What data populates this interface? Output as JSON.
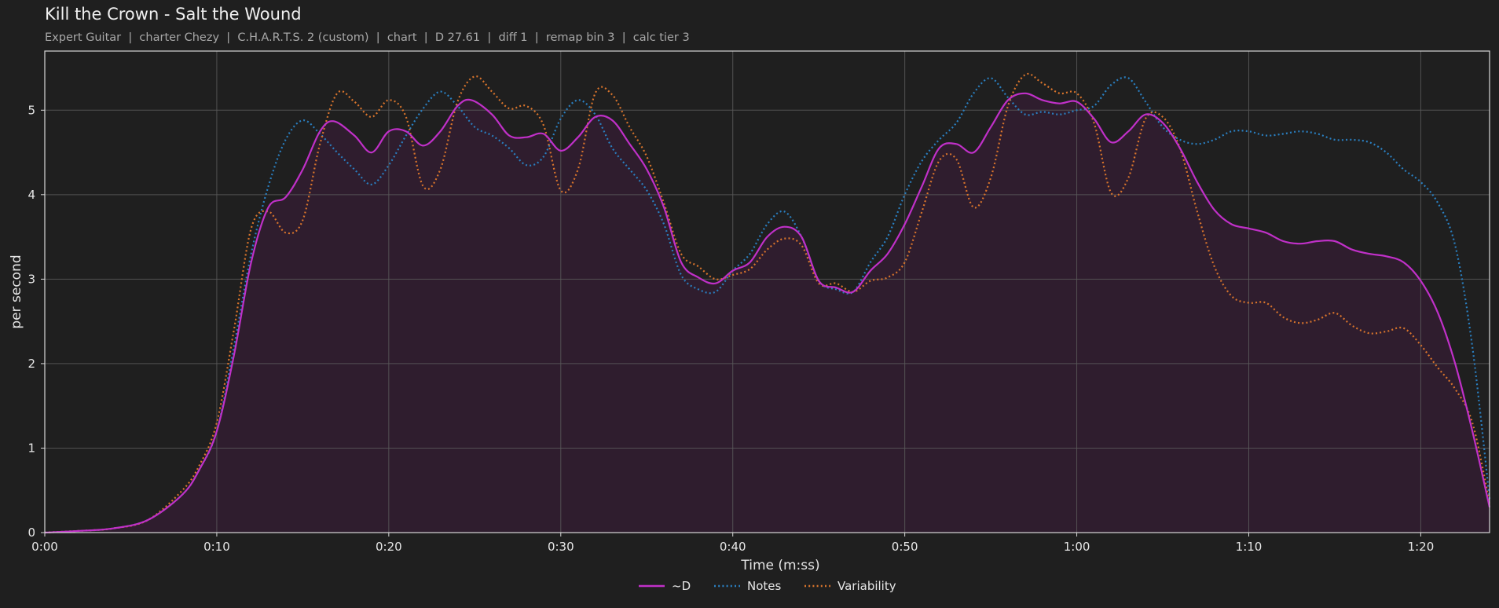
{
  "title": "Kill the Crown - Salt the Wound",
  "subtitle": "Expert Guitar  |  charter Chezy  |  C.H.A.R.T.S. 2 (custom)  |  chart  |  D 27.61  |  diff 1  |  remap bin 3  |  calc tier 3",
  "colors": {
    "background": "#1f1f1f",
    "grid": "#5a5a5a",
    "axis": "#d8d8d8",
    "fill": "#2f1d2e"
  },
  "chart_data": {
    "type": "line",
    "xlabel": "Time (m:ss)",
    "ylabel": "per second",
    "xlim": [
      0,
      84
    ],
    "ylim": [
      0,
      5.7
    ],
    "grid": true,
    "legend_position": "bottom-center",
    "x_ticks": [
      0,
      10,
      20,
      30,
      40,
      50,
      60,
      70,
      80
    ],
    "x_tick_labels": [
      "0:00",
      "0:10",
      "0:20",
      "0:30",
      "0:40",
      "0:50",
      "1:00",
      "1:10",
      "1:20"
    ],
    "y_ticks": [
      0,
      1,
      2,
      3,
      4,
      5
    ],
    "y_tick_labels": [
      "0",
      "1",
      "2",
      "3",
      "4",
      "5"
    ],
    "series": [
      {
        "name": "~D",
        "color": "#c030c8",
        "style": "solid",
        "filled": true,
        "points": [
          [
            0,
            0
          ],
          [
            2,
            0.02
          ],
          [
            4,
            0.05
          ],
          [
            6,
            0.15
          ],
          [
            8,
            0.45
          ],
          [
            9,
            0.75
          ],
          [
            10,
            1.2
          ],
          [
            11,
            2.1
          ],
          [
            12,
            3.2
          ],
          [
            13,
            3.85
          ],
          [
            14,
            3.97
          ],
          [
            15,
            4.3
          ],
          [
            16,
            4.75
          ],
          [
            16.8,
            4.87
          ],
          [
            18,
            4.7
          ],
          [
            19,
            4.5
          ],
          [
            20,
            4.75
          ],
          [
            21,
            4.75
          ],
          [
            22,
            4.58
          ],
          [
            23,
            4.75
          ],
          [
            24,
            5.05
          ],
          [
            24.8,
            5.12
          ],
          [
            26,
            4.95
          ],
          [
            27,
            4.7
          ],
          [
            28,
            4.68
          ],
          [
            29,
            4.72
          ],
          [
            30,
            4.52
          ],
          [
            31,
            4.68
          ],
          [
            32,
            4.92
          ],
          [
            33,
            4.88
          ],
          [
            34,
            4.6
          ],
          [
            35,
            4.3
          ],
          [
            36,
            3.85
          ],
          [
            37,
            3.2
          ],
          [
            38,
            3.02
          ],
          [
            39,
            2.95
          ],
          [
            40,
            3.1
          ],
          [
            41,
            3.2
          ],
          [
            42,
            3.5
          ],
          [
            43,
            3.62
          ],
          [
            44,
            3.5
          ],
          [
            45,
            2.98
          ],
          [
            46,
            2.9
          ],
          [
            47,
            2.85
          ],
          [
            48,
            3.1
          ],
          [
            49,
            3.3
          ],
          [
            50,
            3.65
          ],
          [
            51,
            4.1
          ],
          [
            52,
            4.55
          ],
          [
            53,
            4.6
          ],
          [
            54,
            4.5
          ],
          [
            55,
            4.8
          ],
          [
            56,
            5.12
          ],
          [
            57,
            5.2
          ],
          [
            58,
            5.12
          ],
          [
            59,
            5.08
          ],
          [
            60,
            5.1
          ],
          [
            61,
            4.9
          ],
          [
            62,
            4.62
          ],
          [
            63,
            4.75
          ],
          [
            64,
            4.95
          ],
          [
            65,
            4.85
          ],
          [
            66,
            4.55
          ],
          [
            67,
            4.15
          ],
          [
            68,
            3.82
          ],
          [
            69,
            3.65
          ],
          [
            70,
            3.6
          ],
          [
            71,
            3.55
          ],
          [
            72,
            3.45
          ],
          [
            73,
            3.42
          ],
          [
            74,
            3.45
          ],
          [
            75,
            3.45
          ],
          [
            76,
            3.35
          ],
          [
            77,
            3.3
          ],
          [
            78,
            3.27
          ],
          [
            79,
            3.2
          ],
          [
            80,
            2.98
          ],
          [
            81,
            2.6
          ],
          [
            82,
            2.0
          ],
          [
            83,
            1.2
          ],
          [
            84,
            0.3
          ]
        ]
      },
      {
        "name": "Notes",
        "color": "#2a7fc0",
        "style": "dotted",
        "filled": false,
        "points": [
          [
            0,
            0
          ],
          [
            2,
            0.02
          ],
          [
            4,
            0.05
          ],
          [
            6,
            0.15
          ],
          [
            8,
            0.45
          ],
          [
            9,
            0.75
          ],
          [
            10,
            1.2
          ],
          [
            11,
            2.2
          ],
          [
            12,
            3.3
          ],
          [
            13,
            4.1
          ],
          [
            14,
            4.65
          ],
          [
            15,
            4.88
          ],
          [
            16,
            4.72
          ],
          [
            17,
            4.5
          ],
          [
            18,
            4.3
          ],
          [
            19,
            4.12
          ],
          [
            20,
            4.35
          ],
          [
            21,
            4.7
          ],
          [
            22,
            5.02
          ],
          [
            23,
            5.22
          ],
          [
            24,
            5.05
          ],
          [
            25,
            4.8
          ],
          [
            26,
            4.7
          ],
          [
            27,
            4.55
          ],
          [
            28,
            4.35
          ],
          [
            29,
            4.45
          ],
          [
            30,
            4.9
          ],
          [
            31,
            5.12
          ],
          [
            32,
            4.95
          ],
          [
            33,
            4.55
          ],
          [
            34,
            4.3
          ],
          [
            35,
            4.05
          ],
          [
            36,
            3.65
          ],
          [
            37,
            3.05
          ],
          [
            38,
            2.88
          ],
          [
            39,
            2.85
          ],
          [
            40,
            3.1
          ],
          [
            41,
            3.3
          ],
          [
            42,
            3.65
          ],
          [
            43,
            3.8
          ],
          [
            44,
            3.5
          ],
          [
            45,
            2.98
          ],
          [
            46,
            2.88
          ],
          [
            47,
            2.85
          ],
          [
            48,
            3.2
          ],
          [
            49,
            3.5
          ],
          [
            50,
            4.0
          ],
          [
            51,
            4.4
          ],
          [
            52,
            4.65
          ],
          [
            53,
            4.85
          ],
          [
            54,
            5.2
          ],
          [
            55,
            5.38
          ],
          [
            56,
            5.15
          ],
          [
            57,
            4.95
          ],
          [
            58,
            4.98
          ],
          [
            59,
            4.95
          ],
          [
            60,
            5.0
          ],
          [
            61,
            5.05
          ],
          [
            62,
            5.3
          ],
          [
            63,
            5.38
          ],
          [
            64,
            5.1
          ],
          [
            65,
            4.8
          ],
          [
            66,
            4.65
          ],
          [
            67,
            4.6
          ],
          [
            68,
            4.65
          ],
          [
            69,
            4.75
          ],
          [
            70,
            4.75
          ],
          [
            71,
            4.7
          ],
          [
            72,
            4.72
          ],
          [
            73,
            4.75
          ],
          [
            74,
            4.72
          ],
          [
            75,
            4.65
          ],
          [
            76,
            4.65
          ],
          [
            77,
            4.62
          ],
          [
            78,
            4.5
          ],
          [
            79,
            4.3
          ],
          [
            80,
            4.15
          ],
          [
            81,
            3.9
          ],
          [
            82,
            3.4
          ],
          [
            83,
            2.2
          ],
          [
            84,
            0.4
          ]
        ]
      },
      {
        "name": "Variability",
        "color": "#d8742c",
        "style": "dotted",
        "filled": false,
        "points": [
          [
            0,
            0
          ],
          [
            2,
            0.02
          ],
          [
            4,
            0.05
          ],
          [
            6,
            0.15
          ],
          [
            8,
            0.5
          ],
          [
            9,
            0.8
          ],
          [
            10,
            1.3
          ],
          [
            11,
            2.4
          ],
          [
            12,
            3.6
          ],
          [
            13,
            3.8
          ],
          [
            14,
            3.55
          ],
          [
            15,
            3.7
          ],
          [
            16,
            4.6
          ],
          [
            17,
            5.2
          ],
          [
            18,
            5.1
          ],
          [
            19,
            4.92
          ],
          [
            20,
            5.12
          ],
          [
            21,
            4.92
          ],
          [
            22,
            4.1
          ],
          [
            23,
            4.3
          ],
          [
            24,
            5.1
          ],
          [
            25,
            5.4
          ],
          [
            26,
            5.22
          ],
          [
            27,
            5.02
          ],
          [
            28,
            5.05
          ],
          [
            29,
            4.82
          ],
          [
            30,
            4.05
          ],
          [
            31,
            4.3
          ],
          [
            32,
            5.2
          ],
          [
            33,
            5.18
          ],
          [
            34,
            4.8
          ],
          [
            35,
            4.45
          ],
          [
            36,
            3.9
          ],
          [
            37,
            3.3
          ],
          [
            38,
            3.15
          ],
          [
            39,
            3.0
          ],
          [
            40,
            3.05
          ],
          [
            41,
            3.12
          ],
          [
            42,
            3.35
          ],
          [
            43,
            3.48
          ],
          [
            44,
            3.4
          ],
          [
            45,
            2.95
          ],
          [
            46,
            2.95
          ],
          [
            47,
            2.85
          ],
          [
            48,
            2.98
          ],
          [
            49,
            3.02
          ],
          [
            50,
            3.2
          ],
          [
            51,
            3.8
          ],
          [
            52,
            4.4
          ],
          [
            53,
            4.42
          ],
          [
            54,
            3.85
          ],
          [
            55,
            4.2
          ],
          [
            56,
            5.05
          ],
          [
            57,
            5.42
          ],
          [
            58,
            5.32
          ],
          [
            59,
            5.2
          ],
          [
            60,
            5.2
          ],
          [
            61,
            4.85
          ],
          [
            62,
            4.02
          ],
          [
            63,
            4.2
          ],
          [
            64,
            4.9
          ],
          [
            65,
            4.92
          ],
          [
            66,
            4.55
          ],
          [
            67,
            3.8
          ],
          [
            68,
            3.15
          ],
          [
            69,
            2.8
          ],
          [
            70,
            2.72
          ],
          [
            71,
            2.72
          ],
          [
            72,
            2.55
          ],
          [
            73,
            2.48
          ],
          [
            74,
            2.52
          ],
          [
            75,
            2.6
          ],
          [
            76,
            2.45
          ],
          [
            77,
            2.36
          ],
          [
            78,
            2.38
          ],
          [
            79,
            2.42
          ],
          [
            80,
            2.22
          ],
          [
            81,
            1.95
          ],
          [
            82,
            1.7
          ],
          [
            83,
            1.3
          ],
          [
            84,
            0.35
          ]
        ]
      }
    ]
  }
}
